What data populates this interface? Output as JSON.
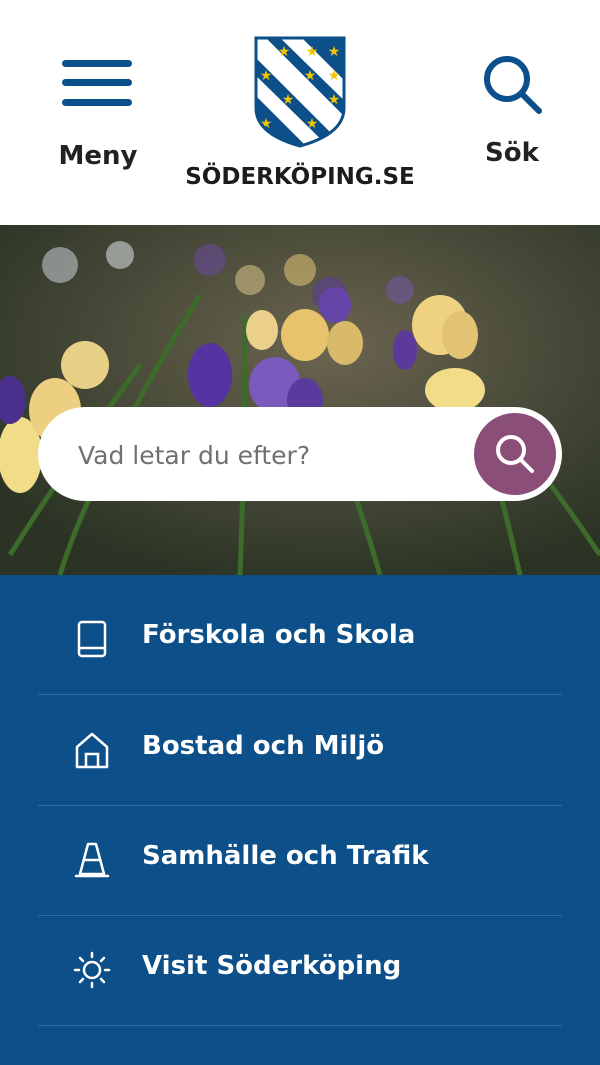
{
  "header": {
    "menu_label": "Meny",
    "search_label": "Sök",
    "logo_text": "SÖDERKÖPING.SE"
  },
  "hero": {
    "search_placeholder": "Vad letar du efter?"
  },
  "nav": {
    "items": [
      {
        "label": "Förskola och Skola",
        "icon": "book-icon"
      },
      {
        "label": "Bostad och Miljö",
        "icon": "house-icon"
      },
      {
        "label": "Samhälle och Trafik",
        "icon": "traffic-cone-icon"
      },
      {
        "label": "Visit Söderköping",
        "icon": "sun-icon"
      }
    ]
  },
  "colors": {
    "brand_blue": "#0d4f88",
    "search_button": "#8b4e78",
    "text_dark": "#222222"
  }
}
